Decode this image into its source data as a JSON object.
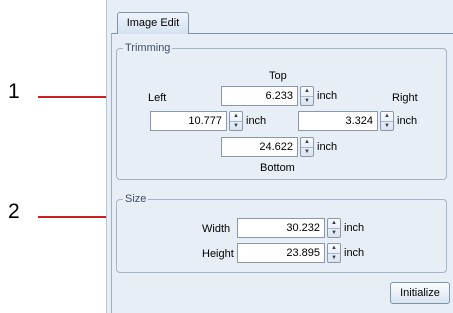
{
  "tab": {
    "label": "Image Edit"
  },
  "callouts": [
    "1",
    "2"
  ],
  "trimming": {
    "legend": "Trimming",
    "top_label": "Top",
    "left_label": "Left",
    "right_label": "Right",
    "bottom_label": "Bottom",
    "top_value": "6.233",
    "left_value": "10.777",
    "right_value": "3.324",
    "bottom_value": "24.622",
    "unit": "inch"
  },
  "size": {
    "legend": "Size",
    "width_label": "Width",
    "height_label": "Height",
    "width_value": "30.232",
    "height_value": "23.895",
    "unit": "inch"
  },
  "initialize_label": "Initialize",
  "colors": {
    "callout_line": "#cc1f1f",
    "panel_bg": "#e8eef6"
  }
}
